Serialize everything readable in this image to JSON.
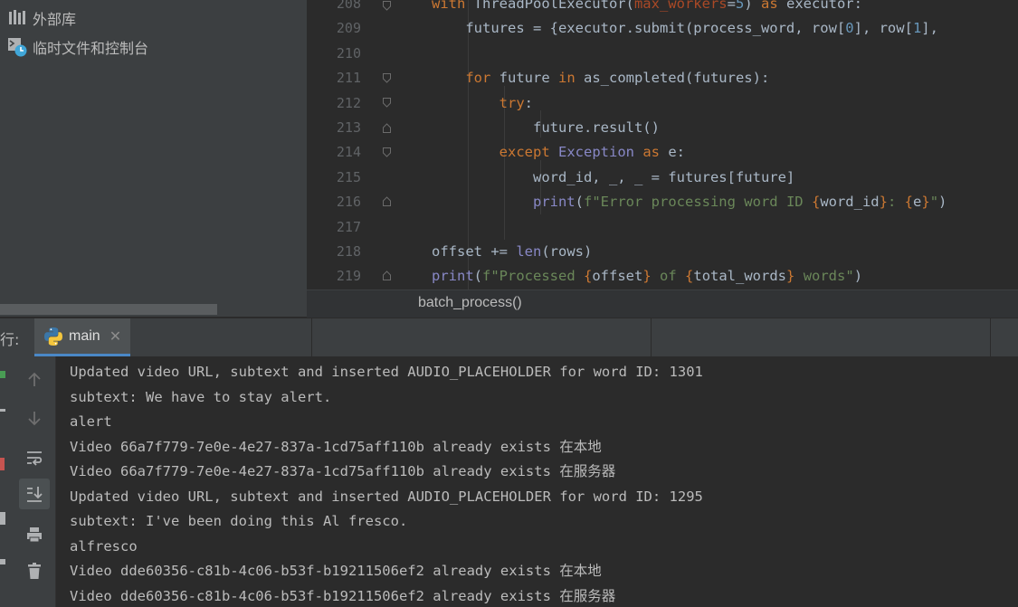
{
  "project": {
    "items": [
      {
        "label": "外部库",
        "icon": "library-icon"
      },
      {
        "label": "临时文件和控制台",
        "icon": "scratches-icon"
      }
    ]
  },
  "editor": {
    "lines": [
      {
        "num": "208",
        "html": "        <span class=\"kw\">with</span> ThreadPoolExecutor(<span class=\"par\">max_workers</span>=<span class=\"num\">5</span>) <span class=\"kw\">as</span> executor:"
      },
      {
        "num": "209",
        "html": "            futures = {executor.submit(process_word, row[<span class=\"num\">0</span>], row[<span class=\"num\">1</span>],"
      },
      {
        "num": "210",
        "html": ""
      },
      {
        "num": "211",
        "html": "            <span class=\"kw\">for</span> future <span class=\"kw\">in</span> as_completed(futures):"
      },
      {
        "num": "212",
        "html": "                <span class=\"kw\">try</span>:"
      },
      {
        "num": "213",
        "html": "                    future.result()"
      },
      {
        "num": "214",
        "html": "                <span class=\"kw\">except</span> <span class=\"bi\">Exception</span> <span class=\"kw\">as</span> e:"
      },
      {
        "num": "215",
        "html": "                    word_id, _, _ = futures[future]"
      },
      {
        "num": "216",
        "html": "                    <span class=\"bi\">print</span>(<span class=\"str\">f\"Error processing word ID </span><span class=\"kw\">{</span>word_id<span class=\"kw\">}</span><span class=\"str\">: </span><span class=\"kw\">{</span>e<span class=\"kw\">}</span><span class=\"str\">\"</span>)"
      },
      {
        "num": "217",
        "html": ""
      },
      {
        "num": "218",
        "html": "        offset += <span class=\"bi\">len</span>(rows)"
      },
      {
        "num": "219",
        "html": "        <span class=\"bi\">print</span>(<span class=\"str\">f\"Processed </span><span class=\"kw\">{</span>offset<span class=\"kw\">}</span><span class=\"str\"> of </span><span class=\"kw\">{</span>total_words<span class=\"kw\">}</span><span class=\"str\"> words\"</span>)"
      }
    ],
    "breadcrumb": "batch_process()"
  },
  "run": {
    "title": "行:",
    "tab_label": "main",
    "tab_close": "✕",
    "toolbar": [
      {
        "name": "scroll-up-button",
        "icon": "arrow-up-icon"
      },
      {
        "name": "scroll-down-button",
        "icon": "arrow-down-icon"
      },
      {
        "name": "soft-wrap-button",
        "icon": "soft-wrap-icon"
      },
      {
        "name": "scroll-to-end-button",
        "icon": "scroll-to-end-icon"
      },
      {
        "name": "print-button",
        "icon": "printer-icon"
      },
      {
        "name": "clear-all-button",
        "icon": "trash-icon"
      }
    ],
    "output": [
      "Updated video URL, subtext and inserted AUDIO_PLACEHOLDER for word ID: 1301",
      "subtext: We have to stay alert.",
      "alert",
      "Video 66a7f779-7e0e-4e27-837a-1cd75aff110b already exists 在本地",
      "Video 66a7f779-7e0e-4e27-837a-1cd75aff110b already exists 在服务器",
      "Updated video URL, subtext and inserted AUDIO_PLACEHOLDER for word ID: 1295",
      "subtext: I've been doing this Al fresco.",
      "alfresco",
      "Video dde60356-c81b-4c06-b53f-b19211506ef2 already exists 在本地",
      "Video dde60356-c81b-4c06-b53f-b19211506ef2 already exists 在服务器"
    ]
  }
}
